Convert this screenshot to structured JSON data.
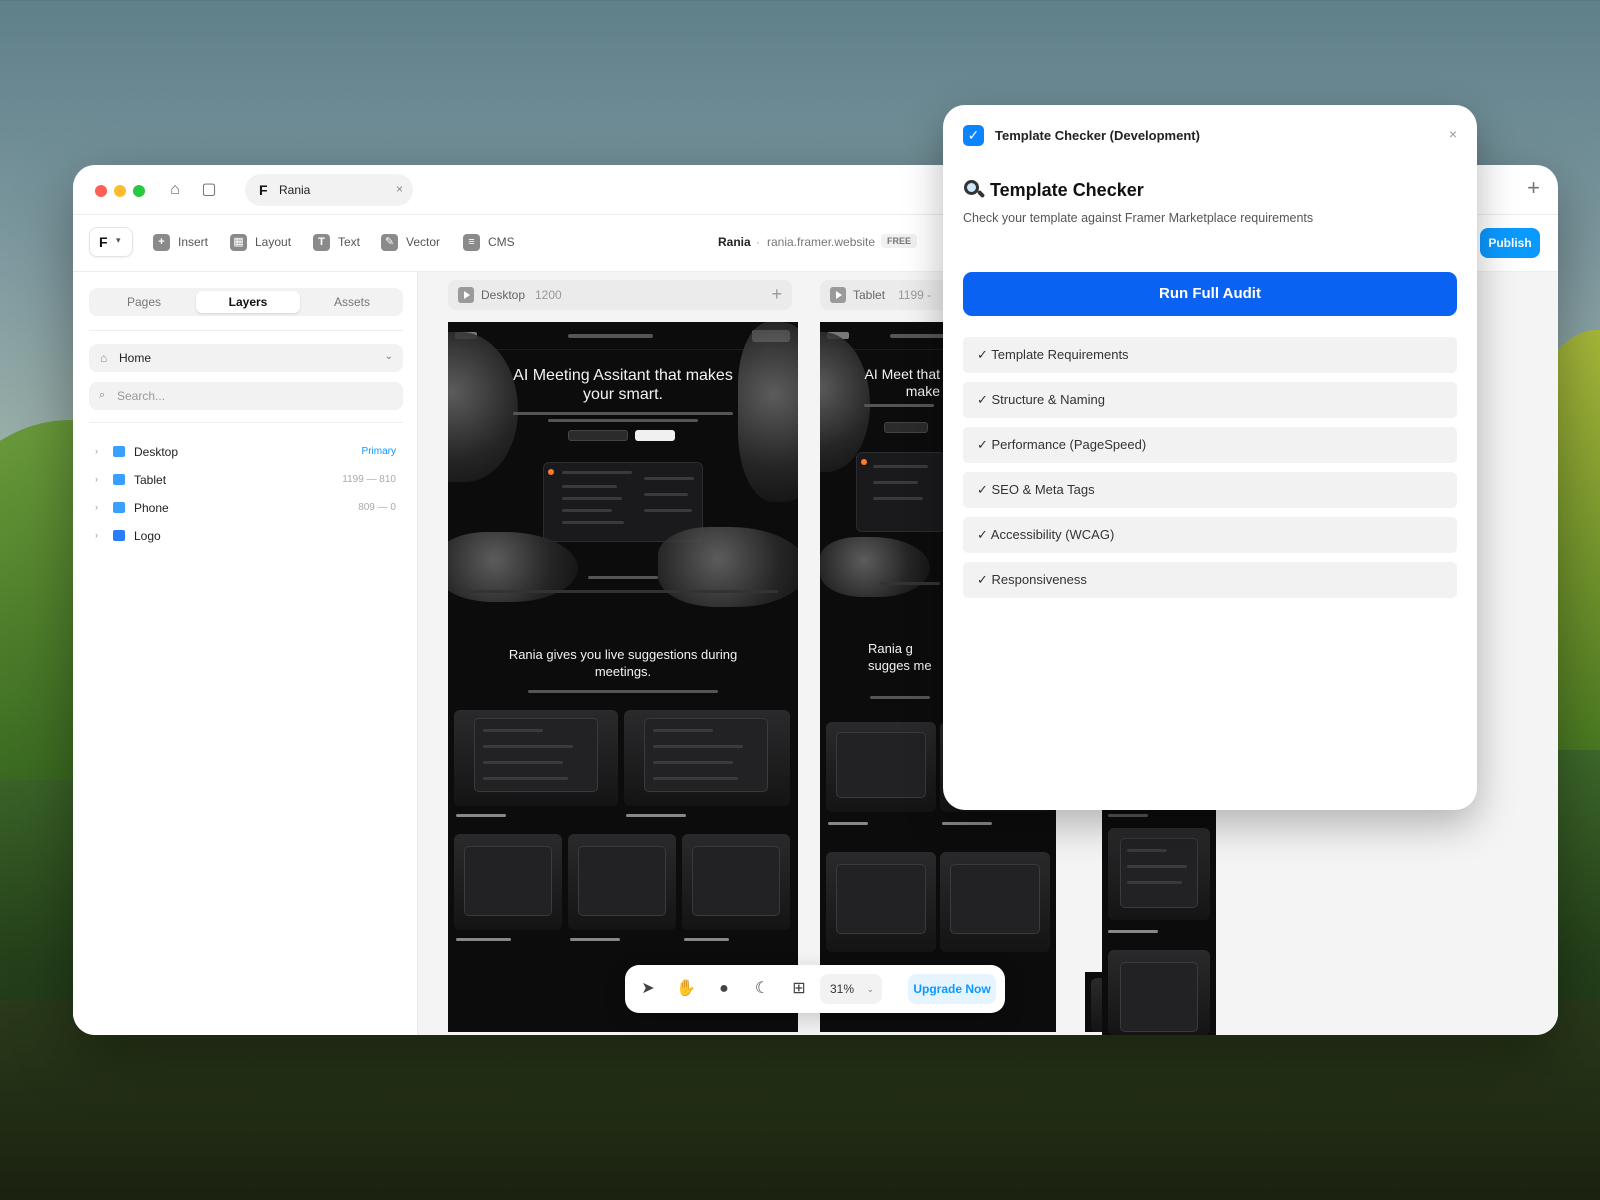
{
  "browser": {
    "tab_label": "Rania",
    "tab_close": "×",
    "new_tab": "+"
  },
  "toolbar": {
    "tools": [
      {
        "label": "Insert",
        "icon": "insert-icon"
      },
      {
        "label": "Layout",
        "icon": "layout-icon"
      },
      {
        "label": "Text",
        "icon": "text-icon"
      },
      {
        "label": "Vector",
        "icon": "vector-icon"
      },
      {
        "label": "CMS",
        "icon": "cms-icon"
      }
    ],
    "site_name": "Rania",
    "site_sep": "·",
    "site_url": "rania.framer.website",
    "plan_badge": "FREE",
    "publish_label": "Publish"
  },
  "left_panel": {
    "tabs": [
      "Pages",
      "Layers",
      "Assets"
    ],
    "active_tab": "Layers",
    "page_select": "Home",
    "search_placeholder": "Search...",
    "layers": [
      {
        "name": "Desktop",
        "meta": "Primary"
      },
      {
        "name": "Tablet",
        "meta": "1199 — 810"
      },
      {
        "name": "Phone",
        "meta": "809 — 0"
      },
      {
        "name": "Logo",
        "meta": ""
      }
    ]
  },
  "canvas": {
    "desktop": {
      "name": "Desktop",
      "size": "1200"
    },
    "tablet": {
      "name": "Tablet",
      "size": "1199 -"
    },
    "desktop_preview": {
      "hero": "AI Meeting Assitant that makes your smart.",
      "section_title": "Rania gives you live suggestions during meetings."
    },
    "tablet_preview": {
      "hero": "AI Meet that make",
      "section_title": "Rania g sugges me"
    }
  },
  "bottom_bar": {
    "zoom": "31%",
    "upgrade_label": "Upgrade Now"
  },
  "plugin": {
    "title": "Template Checker (Development)",
    "close": "×",
    "heading": "Template Checker",
    "subtitle": "Check your template against Framer Marketplace requirements",
    "run_label": "Run Full Audit",
    "checks": [
      "✓ Template Requirements",
      "✓ Structure & Naming",
      "✓ Performance (PageSpeed)",
      "✓ SEO & Meta Tags",
      "✓ Accessibility (WCAG)",
      "✓ Responsiveness"
    ]
  },
  "colors": {
    "accent": "#0a99ff",
    "run_button": "#0a62f2",
    "close_dot": "#ff5f57",
    "minimize_dot": "#febc2e",
    "zoom_dot": "#28c840"
  }
}
